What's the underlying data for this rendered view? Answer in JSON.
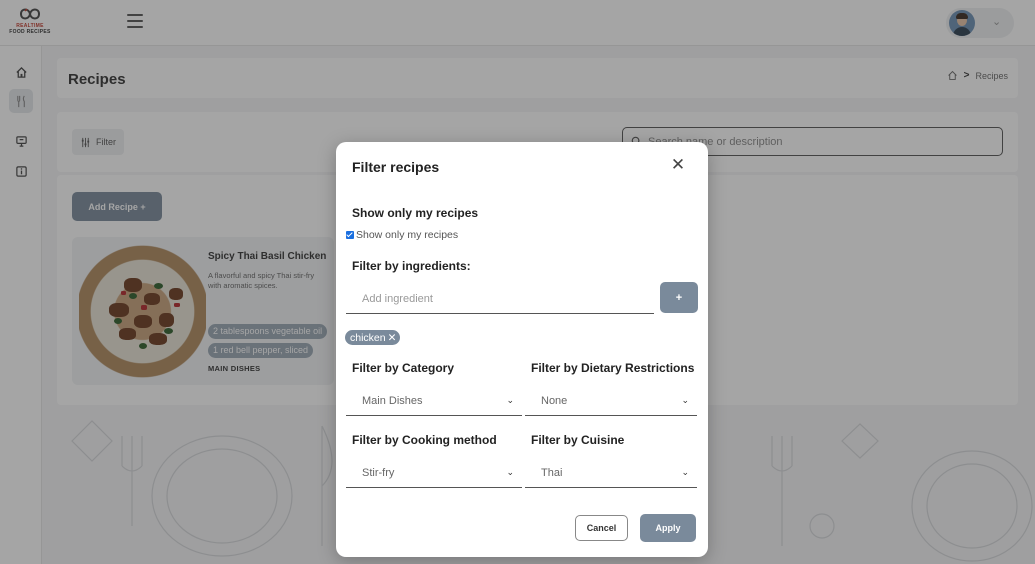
{
  "brand": {
    "line1": "REALTIME",
    "line2": "FOOD RECIPES"
  },
  "header": {
    "user_icon": "user-avatar",
    "menu_icon": "hamburger-icon"
  },
  "sidebar": {
    "items": [
      {
        "icon": "home-icon"
      },
      {
        "icon": "utensils-icon"
      },
      {
        "icon": "monitor-icon"
      },
      {
        "icon": "info-icon"
      }
    ]
  },
  "page": {
    "title": "Recipes",
    "breadcrumb": {
      "current": "Recipes"
    },
    "filter_label": "Filter",
    "search_placeholder": "Search name or description",
    "add_recipe_label": "Add Recipe +"
  },
  "recipe_card": {
    "title": "Spicy Thai Basil Chicken",
    "description": "A flavorful and spicy Thai stir-fry with aromatic spices.",
    "ingredients": [
      "2 tablespoons vegetable oil",
      "1 red bell pepper, sliced"
    ],
    "category": "MAIN DISHES"
  },
  "modal": {
    "title": "Filter recipes",
    "close_label": "✕",
    "my_recipes_heading": "Show only my recipes",
    "my_recipes_checkbox": "Show only my recipes",
    "my_recipes_checked": true,
    "ingredients_heading": "Filter by ingredients:",
    "ingredient_placeholder": "Add ingredient",
    "add_ingredient_label": "+",
    "tags": [
      "chicken"
    ],
    "tag_remove_label": "✕",
    "category_heading": "Filter by Category",
    "category_value": "Main Dishes",
    "dietary_heading": "Filter by Dietary Restrictions",
    "dietary_value": "None",
    "method_heading": "Filter by Cooking method",
    "method_value": "Stir-fry",
    "cuisine_heading": "Filter by Cuisine",
    "cuisine_value": "Thai",
    "cancel_label": "Cancel",
    "apply_label": "Apply"
  },
  "colors": {
    "accent": "#7a8a9b",
    "checkbox": "#1a6fe0",
    "brand_red": "#c0392b"
  }
}
